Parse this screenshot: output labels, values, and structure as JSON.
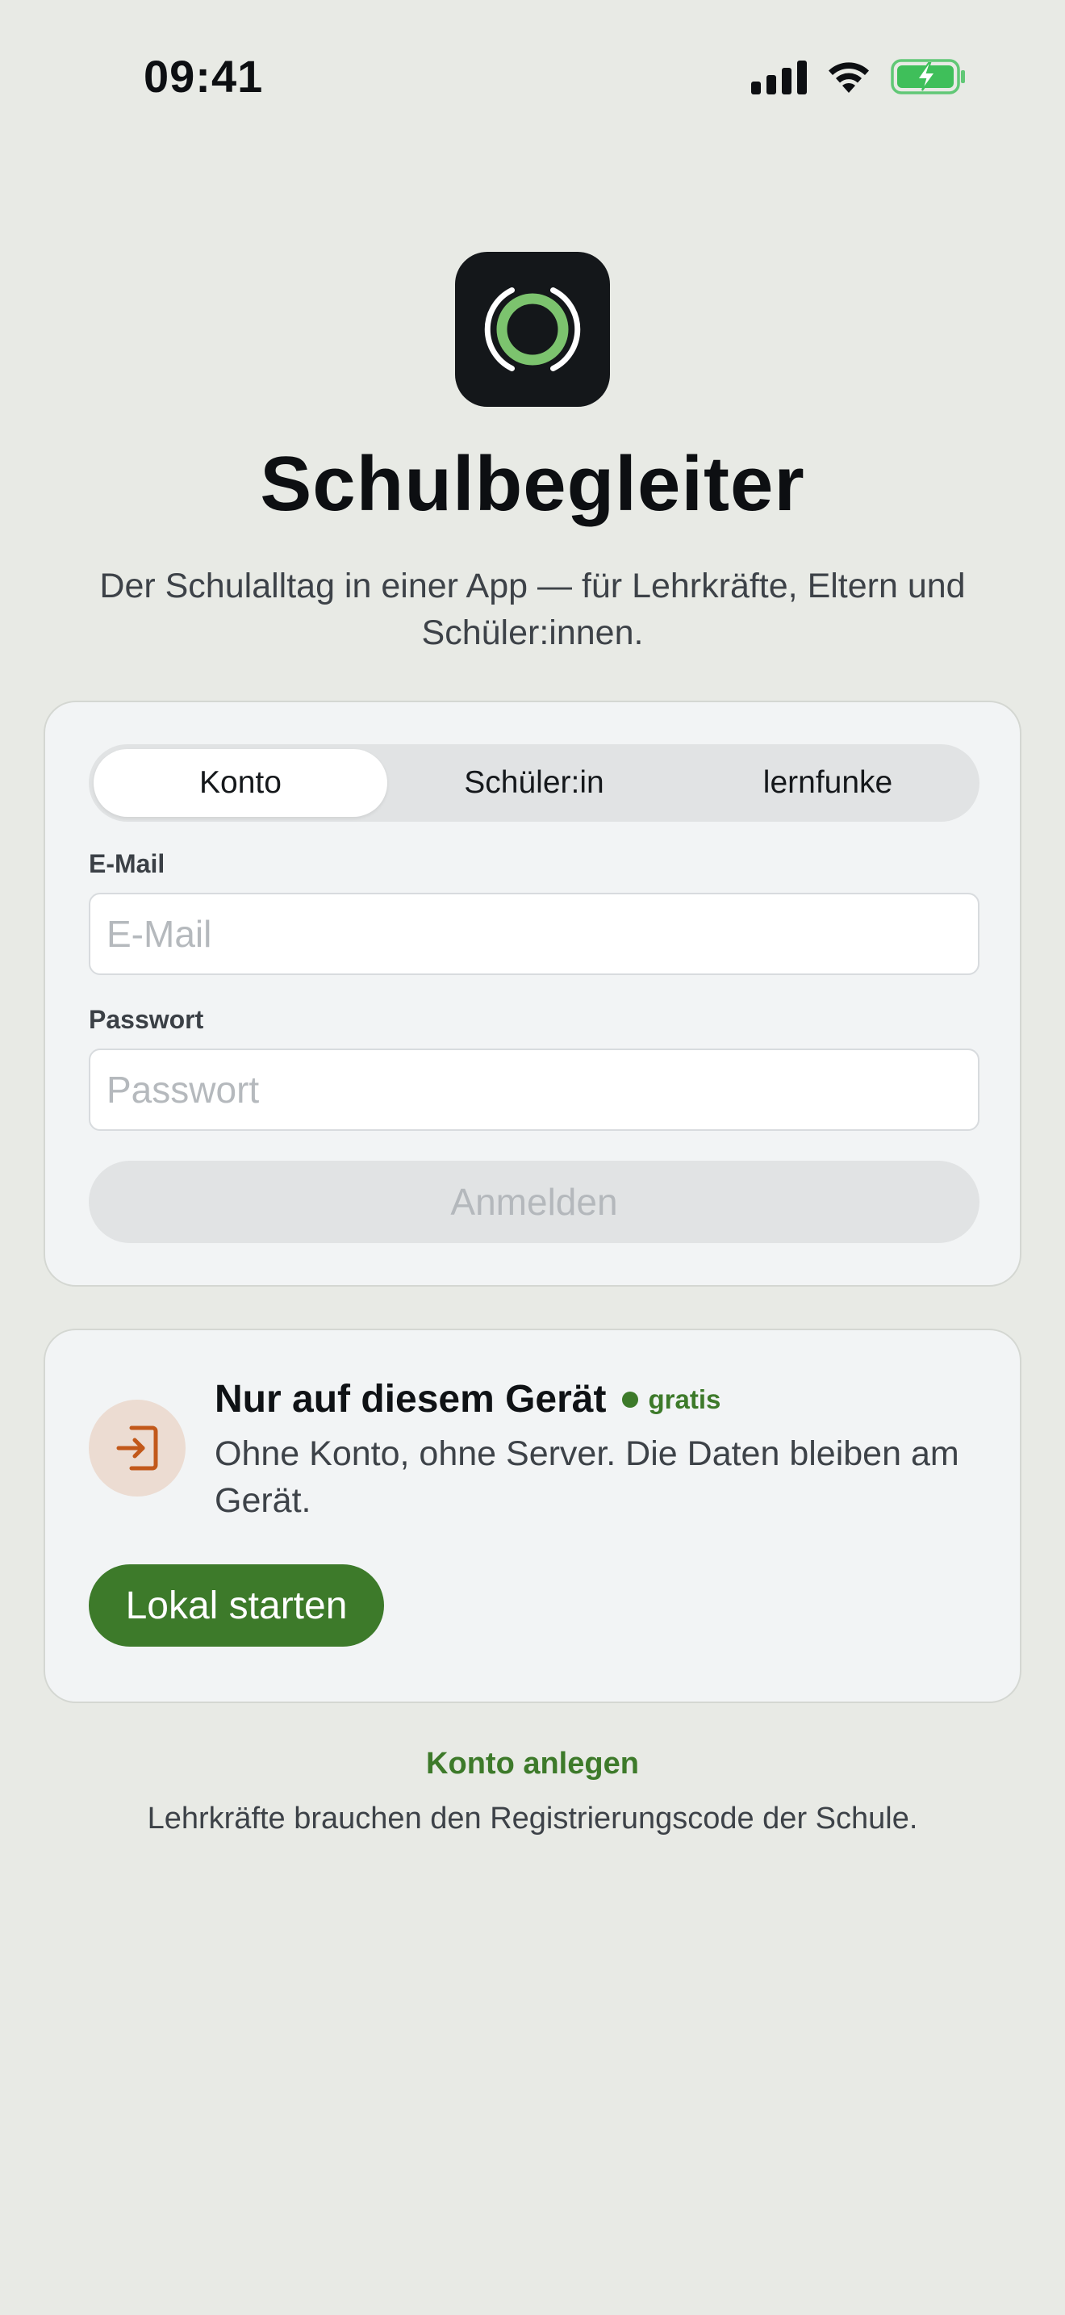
{
  "status_bar": {
    "time": "09:41",
    "icons": [
      "cellular-signal-icon",
      "wifi-icon",
      "battery-charging-icon"
    ]
  },
  "header": {
    "app_icon": "ring-logo-icon",
    "title": "Schulbegleiter",
    "subtitle": "Der Schulalltag in einer App — für Lehrkräfte, Eltern und Schüler:innen."
  },
  "login": {
    "tabs": [
      {
        "label": "Konto",
        "active": true
      },
      {
        "label": "Schüler:in",
        "active": false
      },
      {
        "label": "lernfunke",
        "active": false
      }
    ],
    "email_label": "E-Mail",
    "email_placeholder": "E-Mail",
    "email_value": "",
    "password_label": "Passwort",
    "password_placeholder": "Passwort",
    "password_value": "",
    "submit_label": "Anmelden"
  },
  "local": {
    "icon": "sign-in-icon",
    "title": "Nur auf diesem Gerät",
    "badge": "gratis",
    "description": "Ohne Konto, ohne Server. Die Daten bleiben am Gerät.",
    "button_label": "Lokal starten"
  },
  "footer": {
    "create_account": "Konto anlegen",
    "note": "Lehrkräfte brauchen den Registrierungscode der Schule."
  },
  "colors": {
    "background": "#e8eae5",
    "accent_green": "#3d7a2a",
    "card": "#f2f4f5",
    "icon_dark": "#14171a",
    "logo_ring": "#7cc36e",
    "local_icon": "#c2581a"
  }
}
